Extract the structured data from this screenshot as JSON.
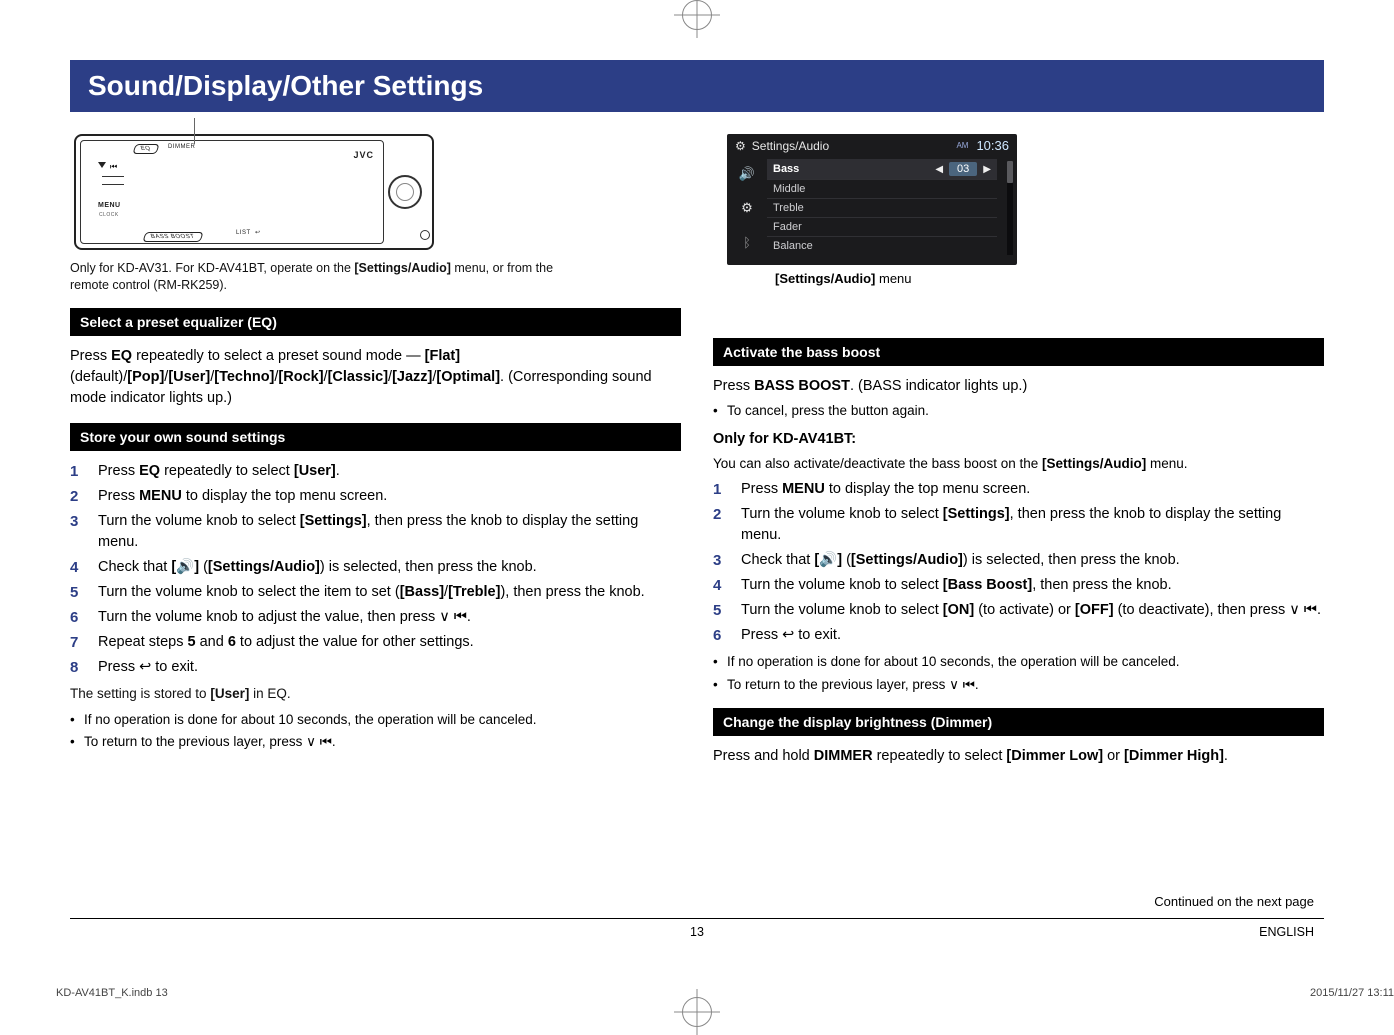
{
  "title": "Sound/Display/Other Settings",
  "device": {
    "eq": "EQ",
    "dimmer": "DIMMER",
    "menu": "MENU",
    "clock": "CLOCK",
    "bass_boost": "BASS BOOST",
    "list": "LIST",
    "brand": "JVC"
  },
  "device_note": {
    "prefix": "Only for KD-AV31. For KD-AV41BT, operate on the ",
    "bold": "[Settings/Audio]",
    "suffix": " menu, or from the remote control (RM-RK259)."
  },
  "screenshot": {
    "header": "Settings/Audio",
    "am": "AM",
    "clock": "10:36",
    "rows": [
      "Bass",
      "Middle",
      "Treble",
      "Fader",
      "Balance"
    ],
    "selected_value": "03",
    "caption_bold": "[Settings/Audio]",
    "caption_rest": " menu"
  },
  "sec_eq": {
    "head": "Select a preset equalizer (EQ)",
    "p_parts": [
      "Press ",
      "EQ",
      " repeatedly to select a preset sound mode — ",
      "[Flat]",
      " (default)/",
      "[Pop]",
      "/",
      "[User]",
      "/",
      "[Techno]",
      "/",
      "[Rock]",
      "/",
      "[Classic]",
      "/",
      "[Jazz]",
      "/",
      "[Optimal]",
      ". (Corresponding sound mode indicator lights up.)"
    ]
  },
  "sec_store": {
    "head": "Store your own sound settings",
    "steps": [
      [
        "Press ",
        "EQ",
        " repeatedly to select ",
        "[User]",
        "."
      ],
      [
        "Press ",
        "MENU",
        " to display the top menu screen."
      ],
      [
        "Turn the volume knob to select ",
        "[Settings]",
        ", then press the knob to display the setting menu."
      ],
      [
        "Check that ",
        "[🔊]",
        " (",
        "[Settings/Audio]",
        ") is selected, then press the knob."
      ],
      [
        "Turn the volume knob to select the item to set (",
        "[Bass]",
        "/",
        "[Treble]",
        "), then press the knob."
      ],
      [
        "Turn the volume knob to adjust the value, then press ",
        "∨ ⏮",
        "."
      ],
      [
        "Repeat steps ",
        "5",
        " and ",
        "6",
        " to adjust the value for other settings."
      ],
      [
        "Press ",
        "↩",
        " to exit."
      ]
    ],
    "after": [
      "The setting is stored to ",
      "[User]",
      " in EQ."
    ],
    "bullets": [
      "If no operation is done for about 10 seconds, the operation will be canceled.",
      "To return to the previous layer, press ∨ ⏮."
    ]
  },
  "sec_bass": {
    "head": "Activate the bass boost",
    "p1": [
      "Press ",
      "BASS BOOST",
      ". (BASS indicator lights up.)"
    ],
    "b1": "To cancel, press the button again.",
    "only_head": "Only for KD-AV41BT:",
    "only_body": [
      "You can also activate/deactivate the bass boost on the ",
      "[Settings/Audio]",
      " menu."
    ],
    "steps": [
      [
        "Press ",
        "MENU",
        " to display the top menu screen."
      ],
      [
        "Turn the volume knob to select ",
        "[Settings]",
        ", then press the knob to display the setting menu."
      ],
      [
        "Check that ",
        "[🔊]",
        " (",
        "[Settings/Audio]",
        ") is selected, then press the knob."
      ],
      [
        "Turn the volume knob to select ",
        "[Bass Boost]",
        ", then press the knob."
      ],
      [
        "Turn the volume knob to select ",
        "[ON]",
        " (to activate) or ",
        "[OFF]",
        " (to deactivate), then press ",
        "∨ ⏮",
        "."
      ],
      [
        "Press ",
        "↩",
        " to exit."
      ]
    ],
    "bullets": [
      "If no operation is done for about 10 seconds, the operation will be canceled.",
      "To return to the previous layer, press ∨ ⏮."
    ]
  },
  "sec_dim": {
    "head": "Change the display brightness (Dimmer)",
    "p": [
      "Press and hold ",
      "DIMMER",
      " repeatedly to select ",
      "[Dimmer Low]",
      " or ",
      "[Dimmer High]",
      "."
    ]
  },
  "footer": {
    "continued": "Continued on the next page",
    "page": "13",
    "lang": "ENGLISH",
    "job_left": "KD-AV41BT_K.indb   13",
    "job_right": "2015/11/27   13:11"
  }
}
